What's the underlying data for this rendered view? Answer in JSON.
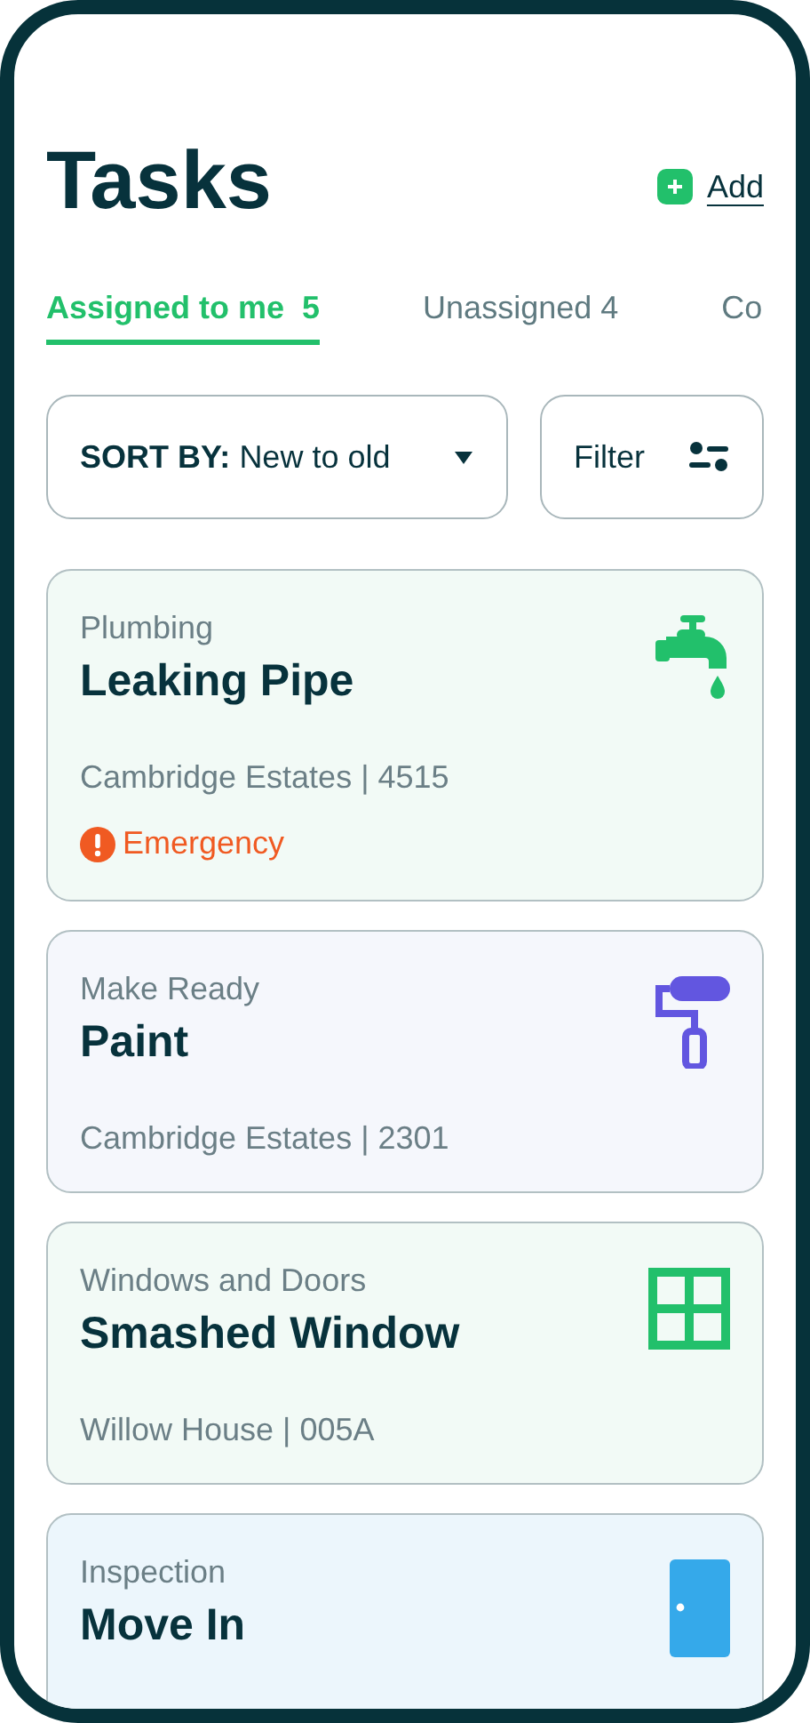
{
  "header": {
    "title": "Tasks",
    "add_label": "Add"
  },
  "tabs": [
    {
      "label": "Assigned to me",
      "count": "5",
      "selected": true
    },
    {
      "label": "Unassigned",
      "count": "4",
      "selected": false
    },
    {
      "label": "Co",
      "selected": false
    }
  ],
  "sort": {
    "label": "SORT BY:",
    "value": "New to old"
  },
  "filter": {
    "label": "Filter"
  },
  "tasks": [
    {
      "kind": "plumbing",
      "category": "Plumbing",
      "title": "Leaking Pipe",
      "location": "Cambridge Estates | 4515",
      "priority": "Emergency"
    },
    {
      "kind": "paint",
      "category": "Make Ready",
      "title": "Paint",
      "location": "Cambridge Estates | 2301"
    },
    {
      "kind": "window",
      "category": "Windows and Doors",
      "title": "Smashed Window",
      "location": "Willow House | 005A"
    },
    {
      "kind": "door",
      "category": "Inspection",
      "title": "Move In"
    }
  ]
}
